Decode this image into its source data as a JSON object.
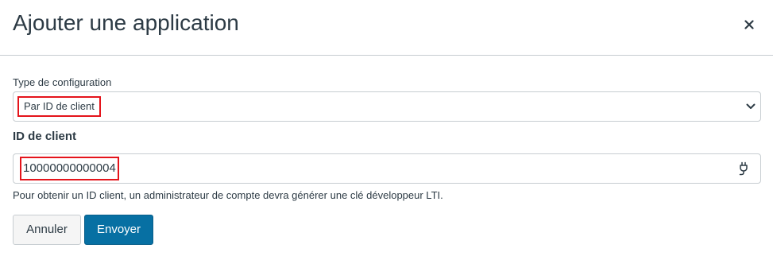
{
  "modal": {
    "title": "Ajouter une application",
    "close_icon": "close-icon"
  },
  "config_type": {
    "label": "Type de configuration",
    "selected": "Par ID de client",
    "chevron_icon": "chevron-down-icon"
  },
  "client_id": {
    "label": "ID de client",
    "value": "10000000000004",
    "plug_icon": "plug-icon",
    "help": "Pour obtenir un ID client, un administrateur de compte devra générer une clé développeur LTI."
  },
  "buttons": {
    "cancel": "Annuler",
    "submit": "Envoyer"
  },
  "colors": {
    "primary": "#0770a3",
    "highlight": "#e4141b",
    "border": "#c7cdd1",
    "text": "#2d3b45"
  }
}
